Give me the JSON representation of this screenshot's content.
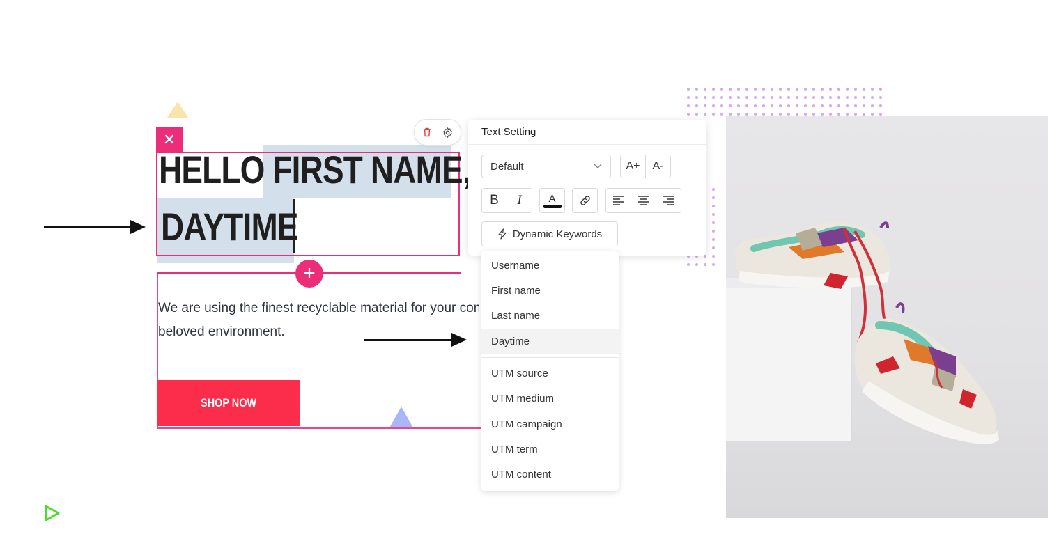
{
  "editor": {
    "close_icon": "close-icon",
    "headline_line1": "HELLO FIRST NAME,",
    "headline_line2": "DAYTIME",
    "add_icon": "plus-icon",
    "body_line1": "We are using the finest recyclable material for your com",
    "body_line2": "beloved environment.",
    "shop_button": "SHOP NOW"
  },
  "mini_toolbar": {
    "delete_icon": "trash-icon",
    "settings_icon": "gear-icon"
  },
  "text_setting": {
    "title": "Text Setting",
    "font_select": "Default",
    "increase_size": "A+",
    "decrease_size": "A-",
    "bold": "B",
    "italic": "I",
    "text_color": "A",
    "dynamic_keywords": "Dynamic Keywords"
  },
  "dropdown": {
    "group1": [
      "Username",
      "First name",
      "Last name",
      "Daytime"
    ],
    "group2": [
      "UTM source",
      "UTM medium",
      "UTM campaign",
      "UTM term",
      "UTM content"
    ],
    "active": "Daytime"
  },
  "colors": {
    "accent": "#ec2d7a",
    "shop_button": "#fb2d4b",
    "selection": "#d3dfea"
  }
}
